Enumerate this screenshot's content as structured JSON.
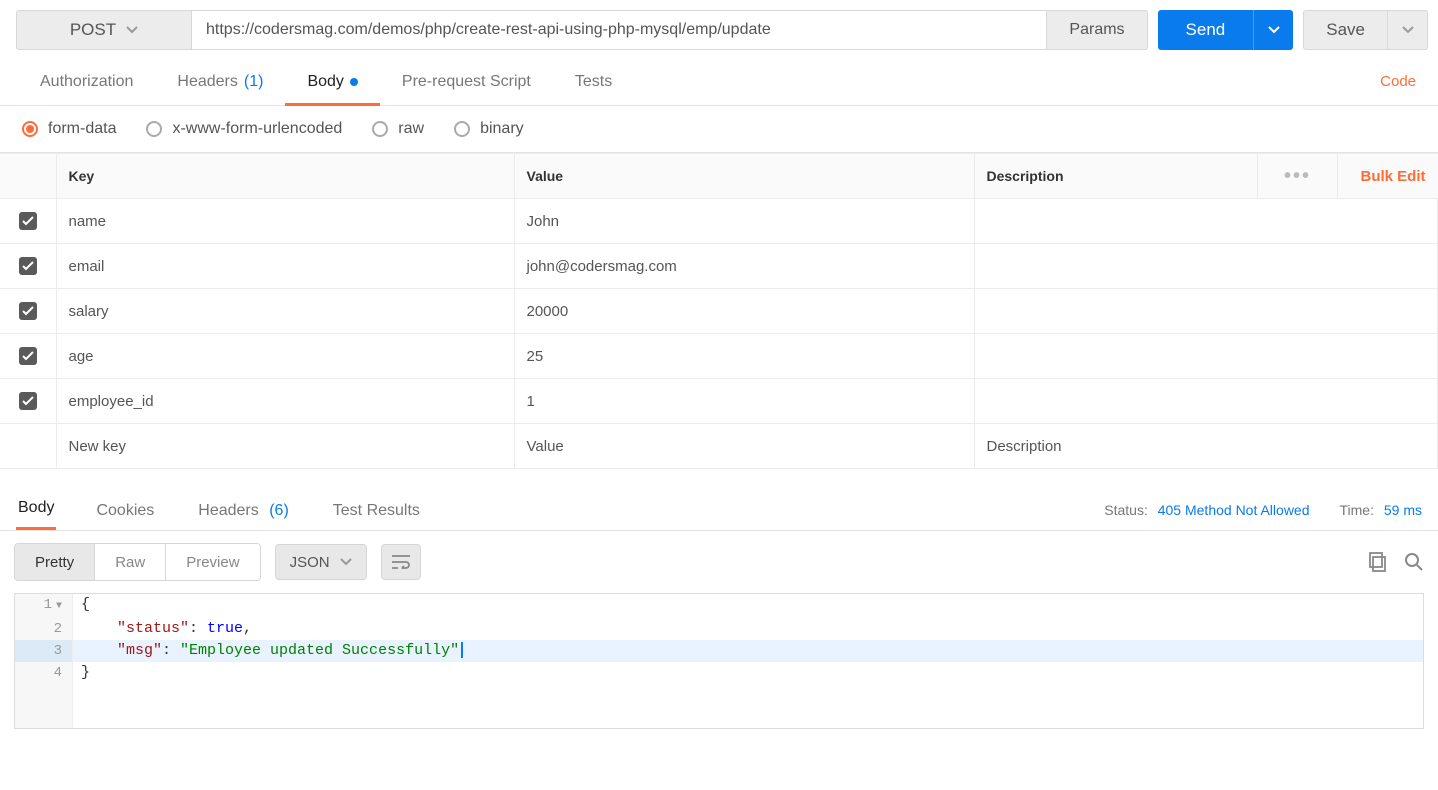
{
  "request": {
    "method": "POST",
    "url": "https://codersmag.com/demos/php/create-rest-api-using-php-mysql/emp/update",
    "params_label": "Params",
    "send_label": "Send",
    "save_label": "Save"
  },
  "req_tabs": {
    "authorization": "Authorization",
    "headers": "Headers",
    "headers_count": "(1)",
    "body": "Body",
    "prerequest": "Pre-request Script",
    "tests": "Tests",
    "code_link": "Code"
  },
  "body_types": {
    "form_data": "form-data",
    "x_www": "x-www-form-urlencoded",
    "raw": "raw",
    "binary": "binary"
  },
  "form_headers": {
    "key": "Key",
    "value": "Value",
    "description": "Description",
    "bulk_edit": "Bulk Edit"
  },
  "form_rows": [
    {
      "checked": true,
      "key": "name",
      "value": "John",
      "description": ""
    },
    {
      "checked": true,
      "key": "email",
      "value": "john@codersmag.com",
      "description": ""
    },
    {
      "checked": true,
      "key": "salary",
      "value": "20000",
      "description": ""
    },
    {
      "checked": true,
      "key": "age",
      "value": "25",
      "description": ""
    },
    {
      "checked": true,
      "key": "employee_id",
      "value": "1",
      "description": ""
    }
  ],
  "form_placeholder": {
    "key": "New key",
    "value": "Value",
    "description": "Description"
  },
  "resp_tabs": {
    "body": "Body",
    "cookies": "Cookies",
    "headers": "Headers",
    "headers_count": "(6)",
    "tests": "Test Results"
  },
  "response_meta": {
    "status_label": "Status:",
    "status_value": "405 Method Not Allowed",
    "time_label": "Time:",
    "time_value": "59 ms"
  },
  "viewer": {
    "pretty": "Pretty",
    "raw": "Raw",
    "preview": "Preview",
    "lang": "JSON"
  },
  "response_body": {
    "line1": "{",
    "line2_key": "\"status\"",
    "line2_val": "true",
    "line3_key": "\"msg\"",
    "line3_val": "\"Employee updated Successfully\"",
    "line4": "}"
  }
}
